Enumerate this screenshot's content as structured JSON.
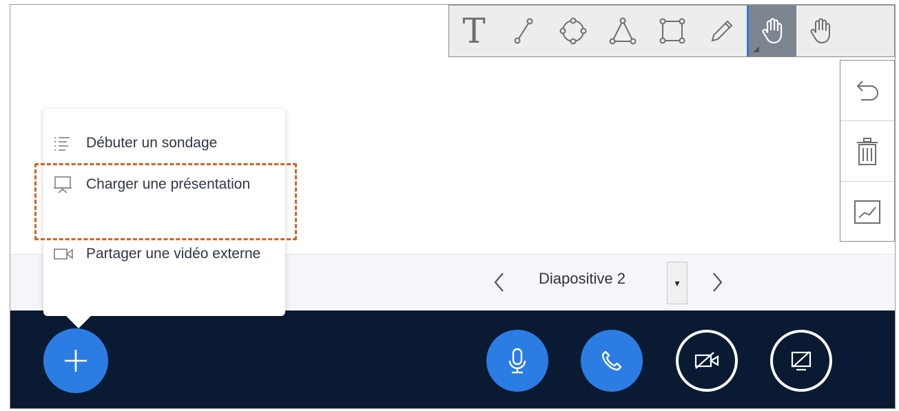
{
  "toolbar": {
    "tools": [
      {
        "icon": "text-tool-icon",
        "label": "T"
      },
      {
        "icon": "line-tool-icon"
      },
      {
        "icon": "ellipse-tool-icon"
      },
      {
        "icon": "triangle-tool-icon"
      },
      {
        "icon": "rectangle-tool-icon"
      },
      {
        "icon": "pencil-tool-icon"
      },
      {
        "icon": "hand-tool-icon",
        "active": true
      },
      {
        "icon": "multi-user-hand-icon"
      }
    ]
  },
  "side_tools": [
    {
      "icon": "undo-icon"
    },
    {
      "icon": "trash-icon"
    },
    {
      "icon": "chart-icon"
    }
  ],
  "menu": {
    "items": [
      {
        "icon": "poll-list-icon",
        "label": "Débuter un sondage"
      },
      {
        "icon": "presentation-icon",
        "label": "Charger une présentation"
      },
      {
        "icon": "video-icon",
        "label": "Partager une vidéo externe"
      }
    ]
  },
  "slide_nav": {
    "label": "Diapositive 2",
    "dropdown_glyph": "▾"
  },
  "actions": {
    "plus": "plus-icon",
    "mic": "microphone-icon",
    "phone": "phone-icon",
    "camera": "camera-off-icon",
    "screen": "screenshare-off-icon"
  },
  "colors": {
    "accent": "#2b7de3",
    "actions_bar": "#0b1a33",
    "highlight": "#d9601f"
  }
}
